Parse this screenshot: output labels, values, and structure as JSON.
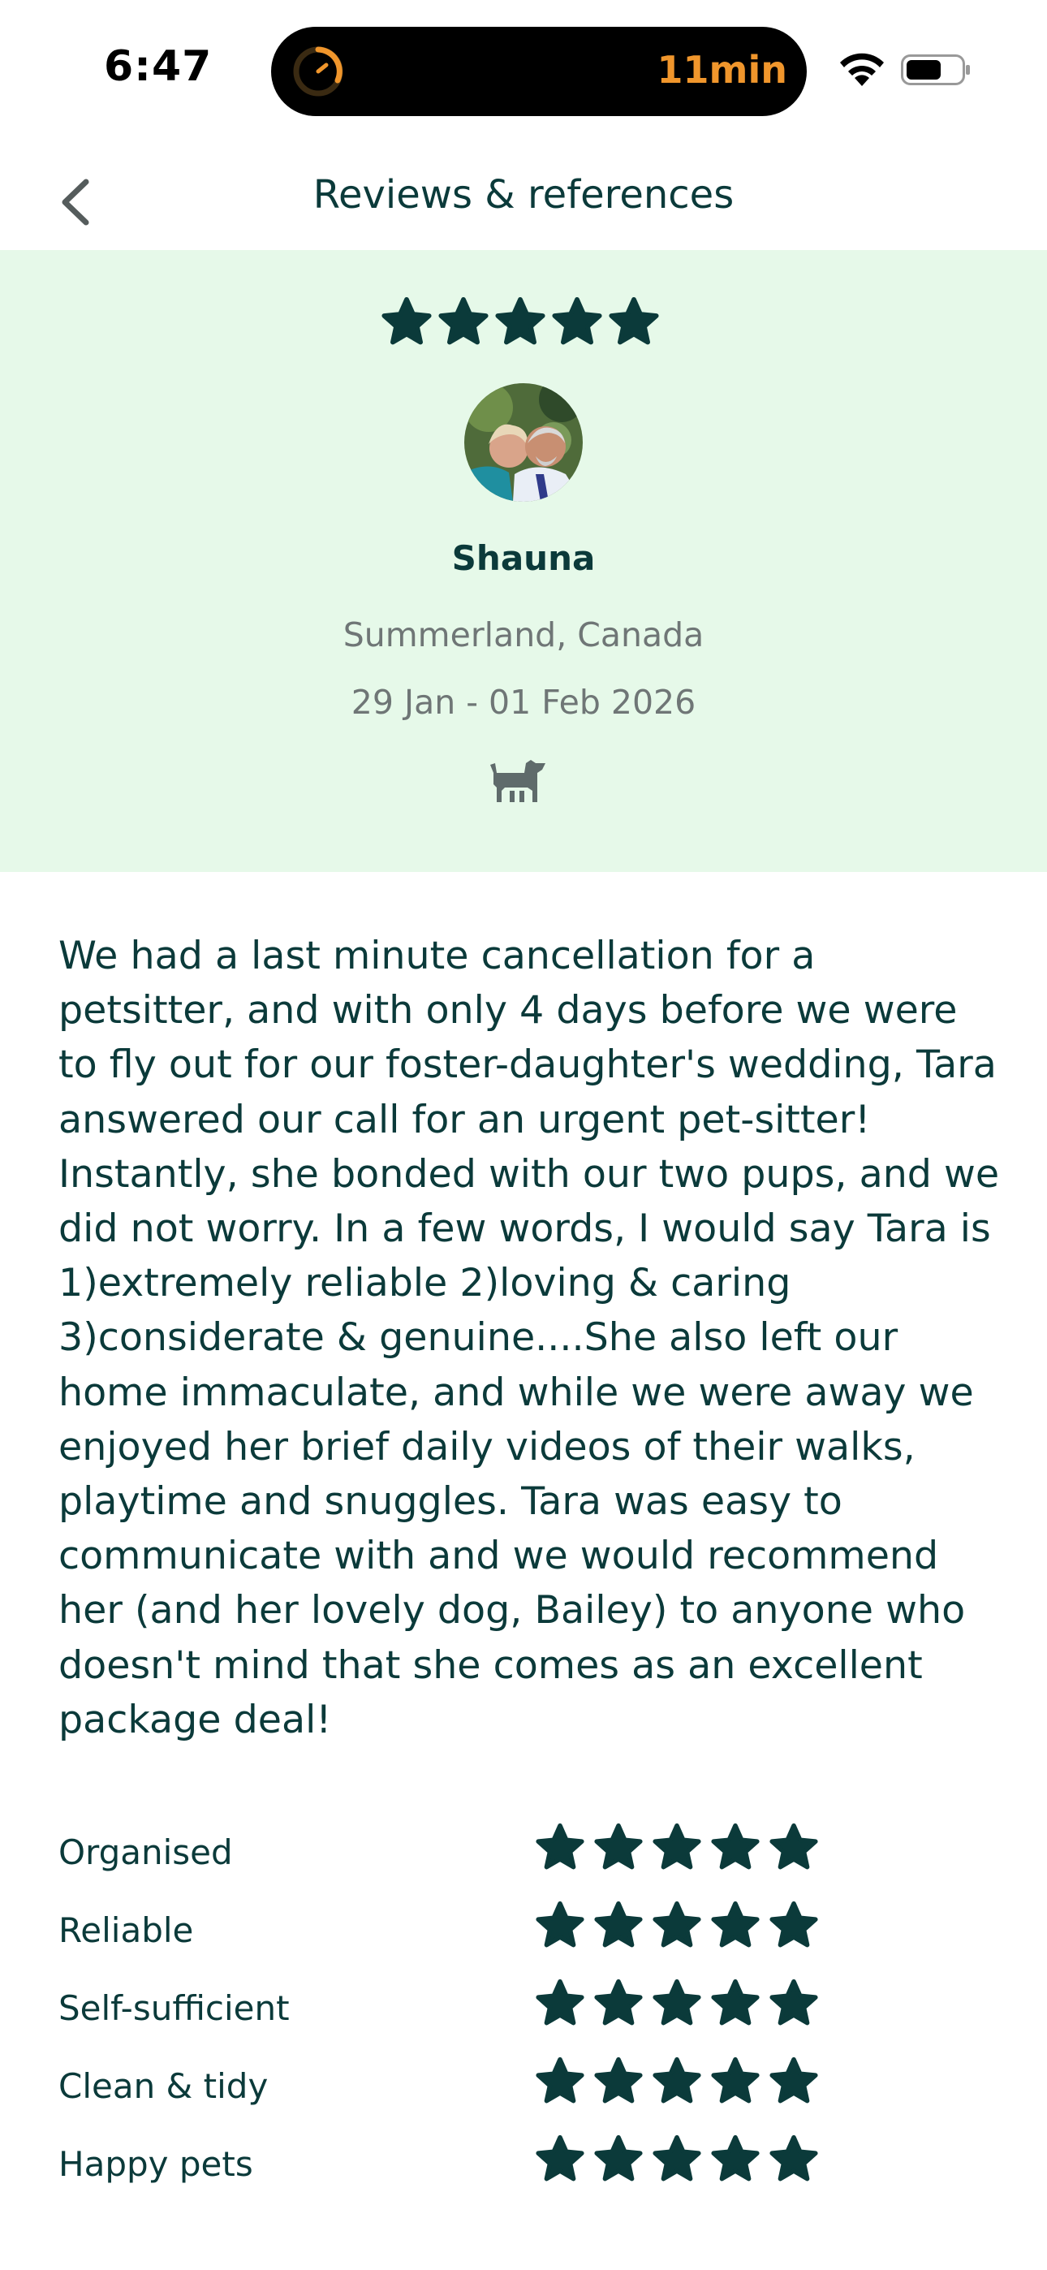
{
  "status_bar": {
    "time": "6:47",
    "activity_timer": "11min"
  },
  "nav": {
    "title": "Reviews & references"
  },
  "review": {
    "rating": 5,
    "reviewer_name": "Shauna",
    "location": "Summerland, Canada",
    "dates": "29 Jan - 01 Feb 2026",
    "text": "We had a last minute cancellation for a petsitter, and with only 4 days before we were to fly out for our foster-daughter's wedding, Tara answered our call for an urgent pet-sitter! Instantly, she bonded with our two pups, and we did not worry.  In a few words, I would say Tara is 1)extremely reliable 2)loving & caring 3)considerate & genuine....She also left our home immaculate, and while we were away we enjoyed her brief daily videos of their walks, playtime and snuggles.  Tara was easy to communicate with and we would recommend her (and her lovely dog, Bailey) to anyone who doesn't mind that she comes as an excellent package deal!"
  },
  "ratings": [
    {
      "label": "Organised",
      "stars": 5
    },
    {
      "label": "Reliable",
      "stars": 5
    },
    {
      "label": "Self-sufficient",
      "stars": 5
    },
    {
      "label": "Clean & tidy",
      "stars": 5
    },
    {
      "label": "Happy pets",
      "stars": 5
    }
  ],
  "colors": {
    "primary_dark": "#0b3a3a",
    "header_bg": "#e6f9e9",
    "muted_text": "#6f7676",
    "timer_orange": "#f0962c"
  },
  "icons": {
    "back": "chevron-left-icon",
    "star": "star-icon",
    "pet_type": "dog-icon",
    "wifi": "wifi-icon",
    "battery": "battery-icon"
  }
}
